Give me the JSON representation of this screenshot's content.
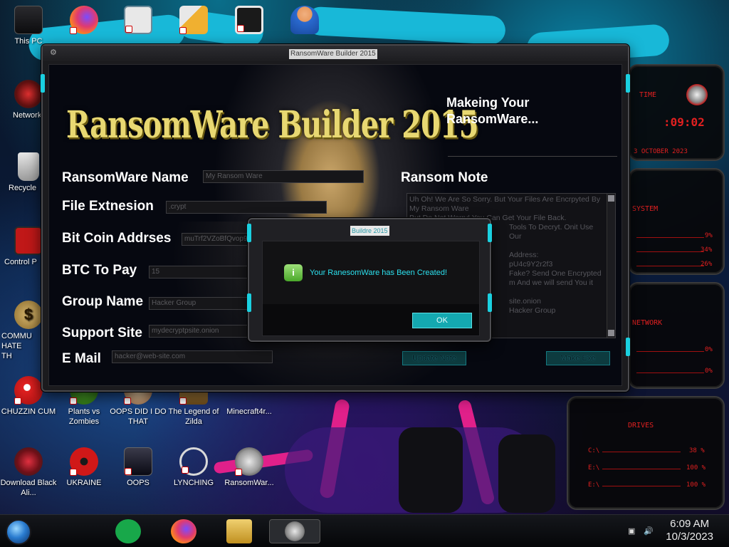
{
  "desktop": {
    "icons": [
      {
        "label": "This PC"
      },
      {
        "label": "Network"
      },
      {
        "label": "Recycle"
      },
      {
        "label": "Control P"
      },
      {
        "label": "COMMU HATE TH"
      },
      {
        "label": "CHUZZIN CUM"
      },
      {
        "label": "Plants vs Zombies"
      },
      {
        "label": "OOPS DID I DO THAT"
      },
      {
        "label": "The Legend of Zilda"
      },
      {
        "label": "Minecraft4r..."
      },
      {
        "label": "Download Black Ali..."
      },
      {
        "label": "UKRAINE"
      },
      {
        "label": "OOPS"
      },
      {
        "label": "LYNCHING"
      },
      {
        "label": "RansomWar..."
      }
    ]
  },
  "gadget": {
    "time_label": "TIME",
    "time": ":09:02",
    "date": "3 OCTOBER 2023",
    "system_label": "SYSTEM",
    "system_values": [
      "9%",
      "34%",
      "26%"
    ],
    "network_label": "NETWORK",
    "network_values": [
      "0%",
      "0%"
    ],
    "drives_label": "DRIVES",
    "drives": [
      {
        "name": "C:\\",
        "value": "38 %"
      },
      {
        "name": "E:\\",
        "value": "100 %"
      },
      {
        "name": "E:\\",
        "value": "100 %"
      }
    ]
  },
  "builder": {
    "window_title": "RansomWare Builder 2015",
    "banner": "RansomWare Builder 2015",
    "subtitle": "Makeing Your RansomWare...",
    "ransom_note_label": "Ransom Note",
    "fields": {
      "name": {
        "label": "RansomWare Name",
        "value": "My Ransom Ware"
      },
      "extension": {
        "label": "File Extnesion",
        "value": ".crypt"
      },
      "bitcoin": {
        "label": "Bit Coin Addrses",
        "value": "muTrf2VZoBfQvop9"
      },
      "btc_pay": {
        "label": "BTC To Pay",
        "value": "15"
      },
      "group": {
        "label": "Group Name",
        "value": "Hacker Group"
      },
      "support": {
        "label": "Support Site",
        "value": "mydecryptpsite.onion"
      },
      "email": {
        "label": "E Mail",
        "value": "hacker@web-site.com"
      }
    },
    "note_lines": [
      "Uh Oh! We Are So Sorry. But Your Files Are Encrpyted By",
      "My Ransom Ware",
      "But Do Not Worry! You Can Get Your File Back.",
      "Tools To Decryt. Onit Use Our",
      "",
      "Address:",
      "pU4c9Y2r2f3",
      "Fake? Send One Encrypted",
      "m And we will send You it",
      "",
      "site.onion",
      "Hacker Group"
    ],
    "update_button": "Update Note",
    "make_button": "Make Exe"
  },
  "dialog": {
    "title": "Buildre 2015",
    "message": "Your RanesomWare has Been Created!",
    "ok": "OK"
  },
  "taskbar": {
    "time": "6:09 AM",
    "date": "10/3/2023"
  },
  "colors": {
    "accent_cyan": "#14a8b0",
    "banner_gold": "#e8d872",
    "gadget_red": "#e02020"
  }
}
